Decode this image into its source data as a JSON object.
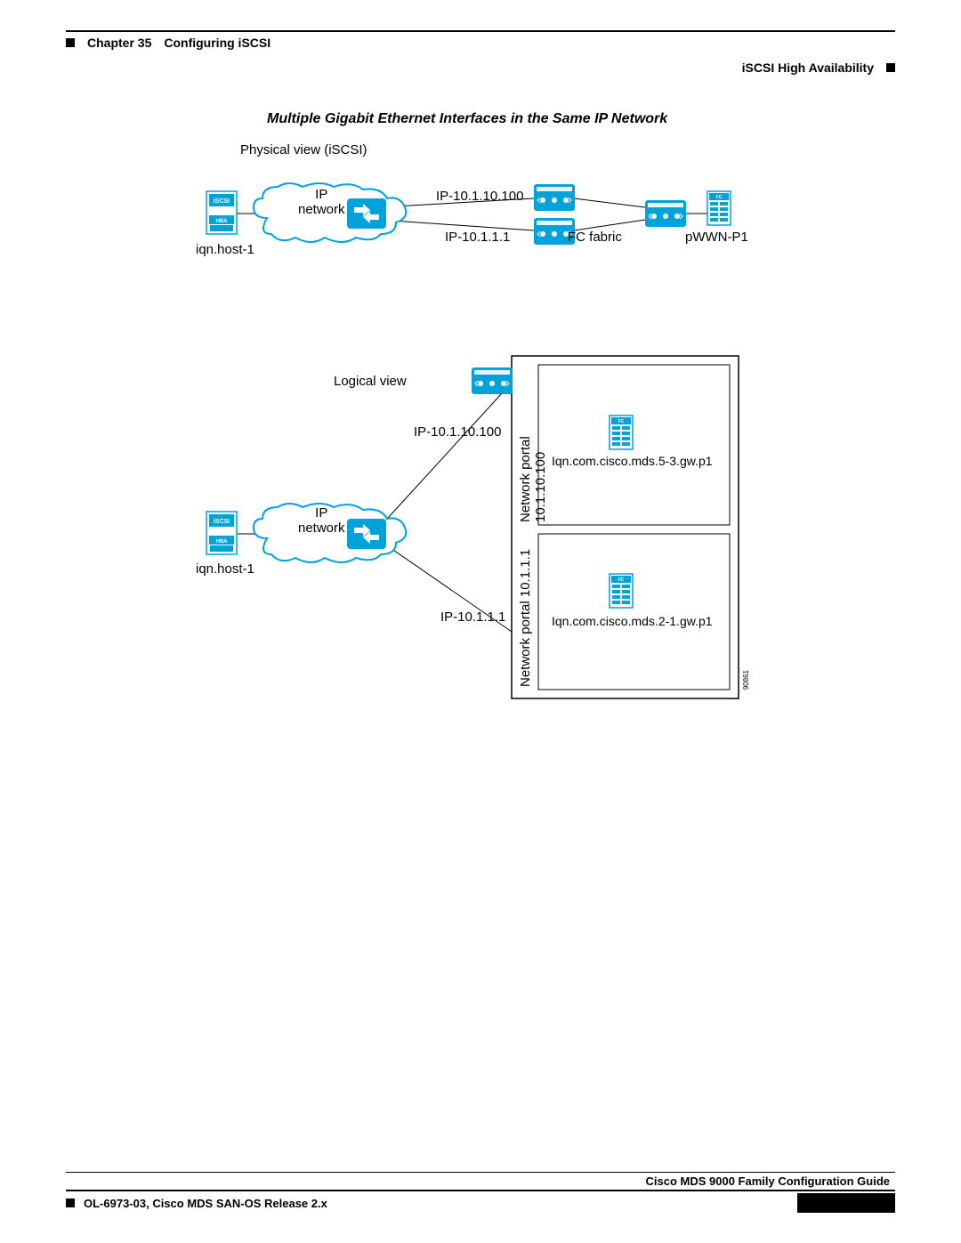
{
  "header": {
    "chapter_prefix": "Chapter 35",
    "chapter_title": "Configuring iSCSI",
    "section": "iSCSI High Availability"
  },
  "figure": {
    "title": "Multiple Gigabit Ethernet Interfaces in the Same IP Network",
    "physical_view_label": "Physical view (iSCSI)",
    "logical_view_label": "Logical view",
    "ip_network_line1": "IP",
    "ip_network_line2": "network",
    "host_label": "iqn.host-1",
    "ip_top": "IP-10.1.10.100",
    "ip_bottom": "IP-10.1.1.1",
    "fc_fabric": "FC fabric",
    "pwwn": "pWWN-P1",
    "portal_top": "Network portal 10.1.10.100",
    "portal_bottom": "Network portal 10.1.1.1",
    "iqn_top": "Iqn.com.cisco.mds.5-3.gw.p1",
    "iqn_bottom": "Iqn.com.cisco.mds.2-1.gw.p1",
    "hba_line1": "iSCSI",
    "hba_line2": "HBA",
    "fc_tag": "FC",
    "image_id": "90861"
  },
  "footer": {
    "guide": "Cisco MDS 9000 Family Configuration Guide",
    "release": "OL-6973-03, Cisco MDS SAN-OS Release 2.x"
  },
  "colors": {
    "cisco_blue": "#00A3D9",
    "cisco_dark": "#007CA8"
  }
}
